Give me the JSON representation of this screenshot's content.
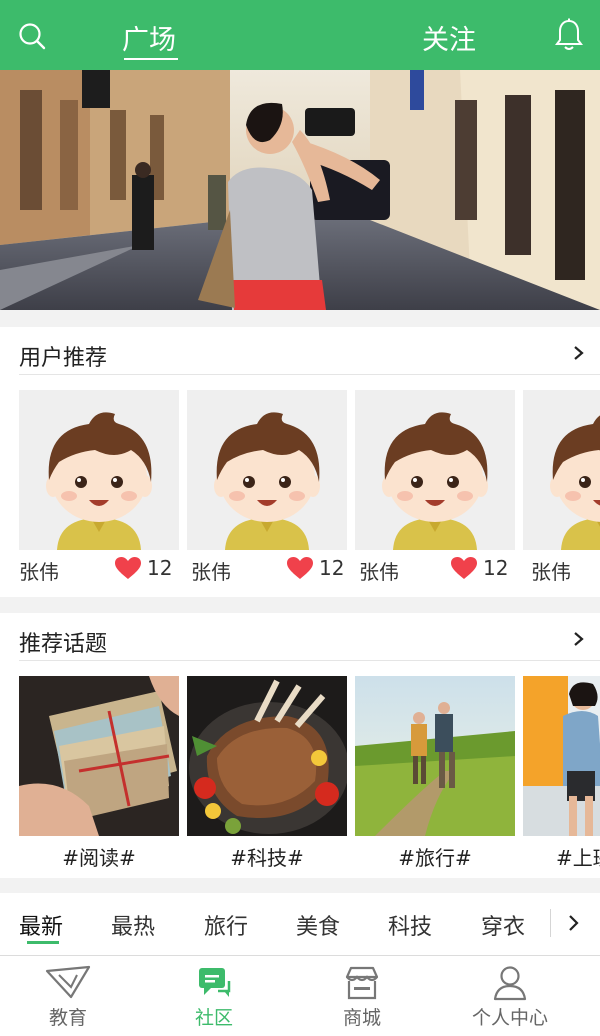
{
  "header": {
    "tabs": [
      {
        "label": "广场",
        "active": true
      },
      {
        "label": "关注",
        "active": false
      }
    ],
    "search_icon": "search-icon",
    "bell_icon": "bell-icon",
    "bg_color": "#3dbb6b"
  },
  "user_section": {
    "title": "用户推荐",
    "users": [
      {
        "name": "张伟",
        "likes": "12"
      },
      {
        "name": "张伟",
        "likes": "12"
      },
      {
        "name": "张伟",
        "likes": "12"
      },
      {
        "name": "张伟",
        "likes": ""
      }
    ]
  },
  "topic_section": {
    "title": "推荐话题",
    "topics": [
      {
        "label": "#阅读#",
        "image": "letters-photo"
      },
      {
        "label": "#科技#",
        "image": "roast-photo"
      },
      {
        "label": "#旅行#",
        "image": "hikers-photo"
      },
      {
        "label": "#上班",
        "image": "woman-photo"
      }
    ]
  },
  "categories": {
    "items": [
      "最新",
      "最热",
      "旅行",
      "美食",
      "科技",
      "穿衣"
    ],
    "active_index": 0
  },
  "bottom_nav": {
    "items": [
      {
        "label": "教育",
        "icon": "education-icon",
        "active": false
      },
      {
        "label": "社区",
        "icon": "community-icon",
        "active": true
      },
      {
        "label": "商城",
        "icon": "store-icon",
        "active": false
      },
      {
        "label": "个人中心",
        "icon": "person-icon",
        "active": false
      }
    ]
  },
  "colors": {
    "accent": "#3dbb6b",
    "heart": "#f0414b"
  }
}
